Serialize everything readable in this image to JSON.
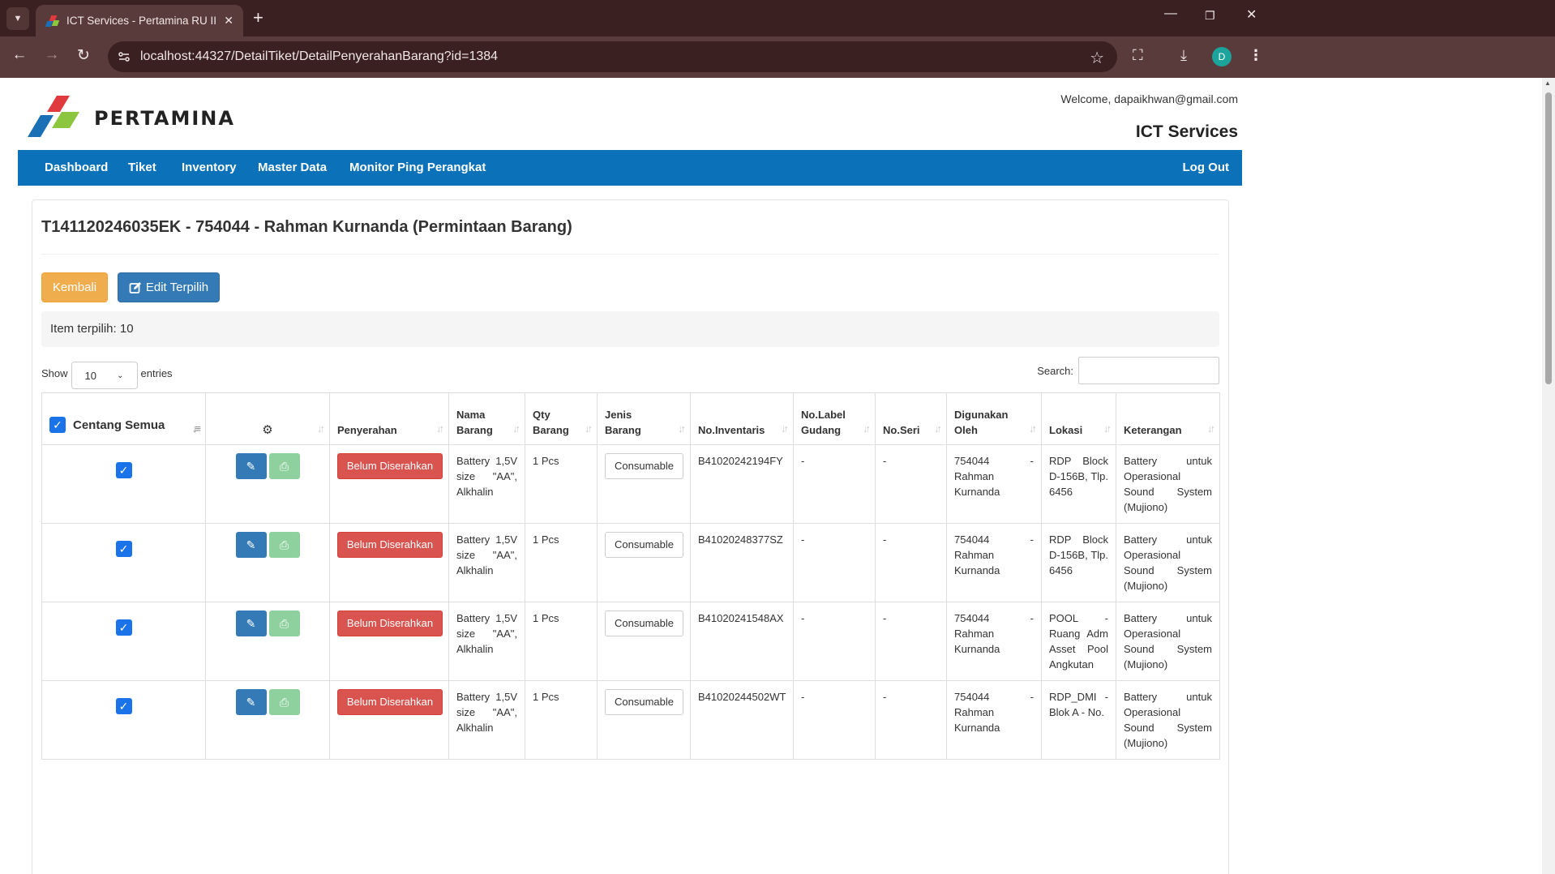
{
  "browser": {
    "tab_title": "ICT Services - Pertamina RU II Dumai",
    "url": "localhost:44327/DetailTiket/DetailPenyerahanBarang?id=1384",
    "profile_initial": "D"
  },
  "header": {
    "brand": "PERTAMINA",
    "welcome": "Welcome, dapaikhwan@gmail.com",
    "app_title": "ICT Services"
  },
  "nav": {
    "items": [
      "Dashboard",
      "Tiket",
      "Inventory",
      "Master Data",
      "Monitor Ping Perangkat"
    ],
    "logout": "Log Out"
  },
  "page": {
    "ticket_title": "T141120246035EK - 754044 - Rahman Kurnanda (Permintaan Barang)",
    "btn_back": "Kembali",
    "btn_edit": "Edit Terpilih",
    "selected_info": "Item terpilih: 10",
    "show_label": "Show",
    "entries_label": "entries",
    "page_size": "10",
    "search_label": "Search:"
  },
  "table": {
    "headers": {
      "select_all": "Centang Semua",
      "penyerahan": "Penyerahan",
      "nama_barang": [
        "Nama",
        "Barang"
      ],
      "qty_barang": [
        "Qty",
        "Barang"
      ],
      "jenis_barang": [
        "Jenis",
        "Barang"
      ],
      "no_inventaris": "No.Inventaris",
      "no_label_gudang": [
        "No.Label",
        "Gudang"
      ],
      "no_seri": "No.Seri",
      "digunakan_oleh": [
        "Digunakan",
        "Oleh"
      ],
      "lokasi": "Lokasi",
      "keterangan": "Keterangan"
    },
    "rows": [
      {
        "status": "Belum Diserahkan",
        "nama": "Battery 1,5V size \"AA\", Alkhalin",
        "qty": "1 Pcs",
        "jenis": "Consumable",
        "inventaris": "B41020242194FY",
        "label_gudang": "-",
        "seri": "-",
        "digunakan_oleh": "754044 - Rahman Kurnanda",
        "lokasi": "RDP Block D-156B, Tlp. 6456",
        "keterangan": "Battery untuk Operasional Sound System (Mujiono)"
      },
      {
        "status": "Belum Diserahkan",
        "nama": "Battery 1,5V size \"AA\", Alkhalin",
        "qty": "1 Pcs",
        "jenis": "Consumable",
        "inventaris": "B41020248377SZ",
        "label_gudang": "-",
        "seri": "-",
        "digunakan_oleh": "754044 - Rahman Kurnanda",
        "lokasi": "RDP Block D-156B, Tlp. 6456",
        "keterangan": "Battery untuk Operasional Sound System (Mujiono)"
      },
      {
        "status": "Belum Diserahkan",
        "nama": "Battery 1,5V size \"AA\", Alkhalin",
        "qty": "1 Pcs",
        "jenis": "Consumable",
        "inventaris": "B41020241548AX",
        "label_gudang": "-",
        "seri": "-",
        "digunakan_oleh": "754044 - Rahman Kurnanda",
        "lokasi": "POOL - Ruang Adm Asset Pool Angkutan",
        "keterangan": "Battery untuk Operasional Sound System (Mujiono)"
      },
      {
        "status": "Belum Diserahkan",
        "nama": "Battery 1,5V size \"AA\", Alkhalin",
        "qty": "1 Pcs",
        "jenis": "Consumable",
        "inventaris": "B41020244502WT",
        "label_gudang": "-",
        "seri": "-",
        "digunakan_oleh": "754044 - Rahman Kurnanda",
        "lokasi": "RDP_DMI - Blok A - No.",
        "keterangan": "Battery untuk Operasional Sound System (Mujiono)"
      }
    ]
  },
  "colors": {
    "nav_bg": "#0b72ba",
    "btn_warning": "#f0ad4e",
    "btn_primary": "#337ab7",
    "btn_danger": "#d9534f",
    "btn_print": "#8fd19e",
    "checkbox": "#1a73e8"
  },
  "icons": [
    "chevron-down-icon",
    "close-icon",
    "plus-icon",
    "minimize-icon",
    "restore-icon",
    "back-arrow-icon",
    "forward-arrow-icon",
    "reload-icon",
    "site-info-icon",
    "star-icon",
    "extensions-icon",
    "download-icon",
    "menu-icon",
    "edit-square-icon",
    "gear-icon",
    "sort-icon",
    "pencil-icon",
    "print-icon",
    "check-icon"
  ]
}
